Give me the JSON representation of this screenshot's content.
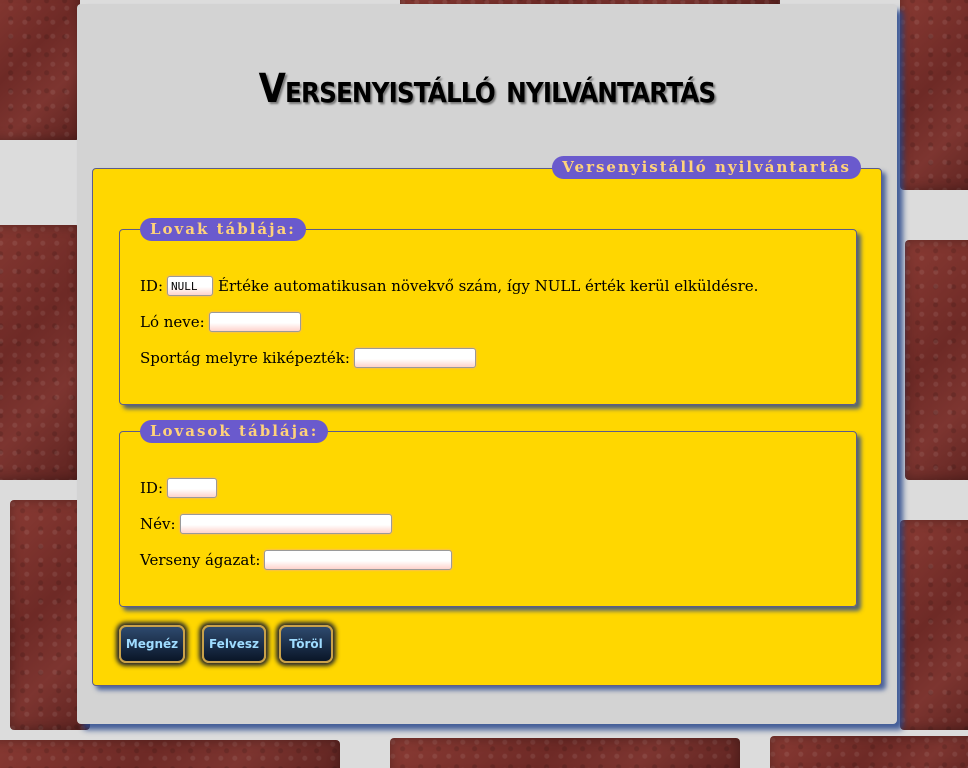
{
  "page": {
    "title": "Versenyistálló nyilvántartás"
  },
  "outer_legend": "Versenyistálló nyilvántartás",
  "horses": {
    "legend": "Lovak táblája:",
    "id_label": "ID:",
    "id_value": "NULL",
    "id_note": "Értéke automatikusan növekvő szám, így NULL érték kerül elküldésre.",
    "name_label": "Ló neve:",
    "name_value": "",
    "sport_label": "Sportág melyre kiképezték:",
    "sport_value": ""
  },
  "riders": {
    "legend": "Lovasok táblája:",
    "id_label": "ID:",
    "id_value": "",
    "name_label": "Név:",
    "name_value": "",
    "branch_label": "Verseny ágazat:",
    "branch_value": ""
  },
  "buttons": {
    "view": "Megnéz",
    "add": "Felvesz",
    "delete": "Töröl"
  },
  "colors": {
    "form_background": "#ffd700",
    "legend_background": "#6a5acd",
    "legend_text": "#ffd27a",
    "panel_background": "#d3d3d3"
  }
}
